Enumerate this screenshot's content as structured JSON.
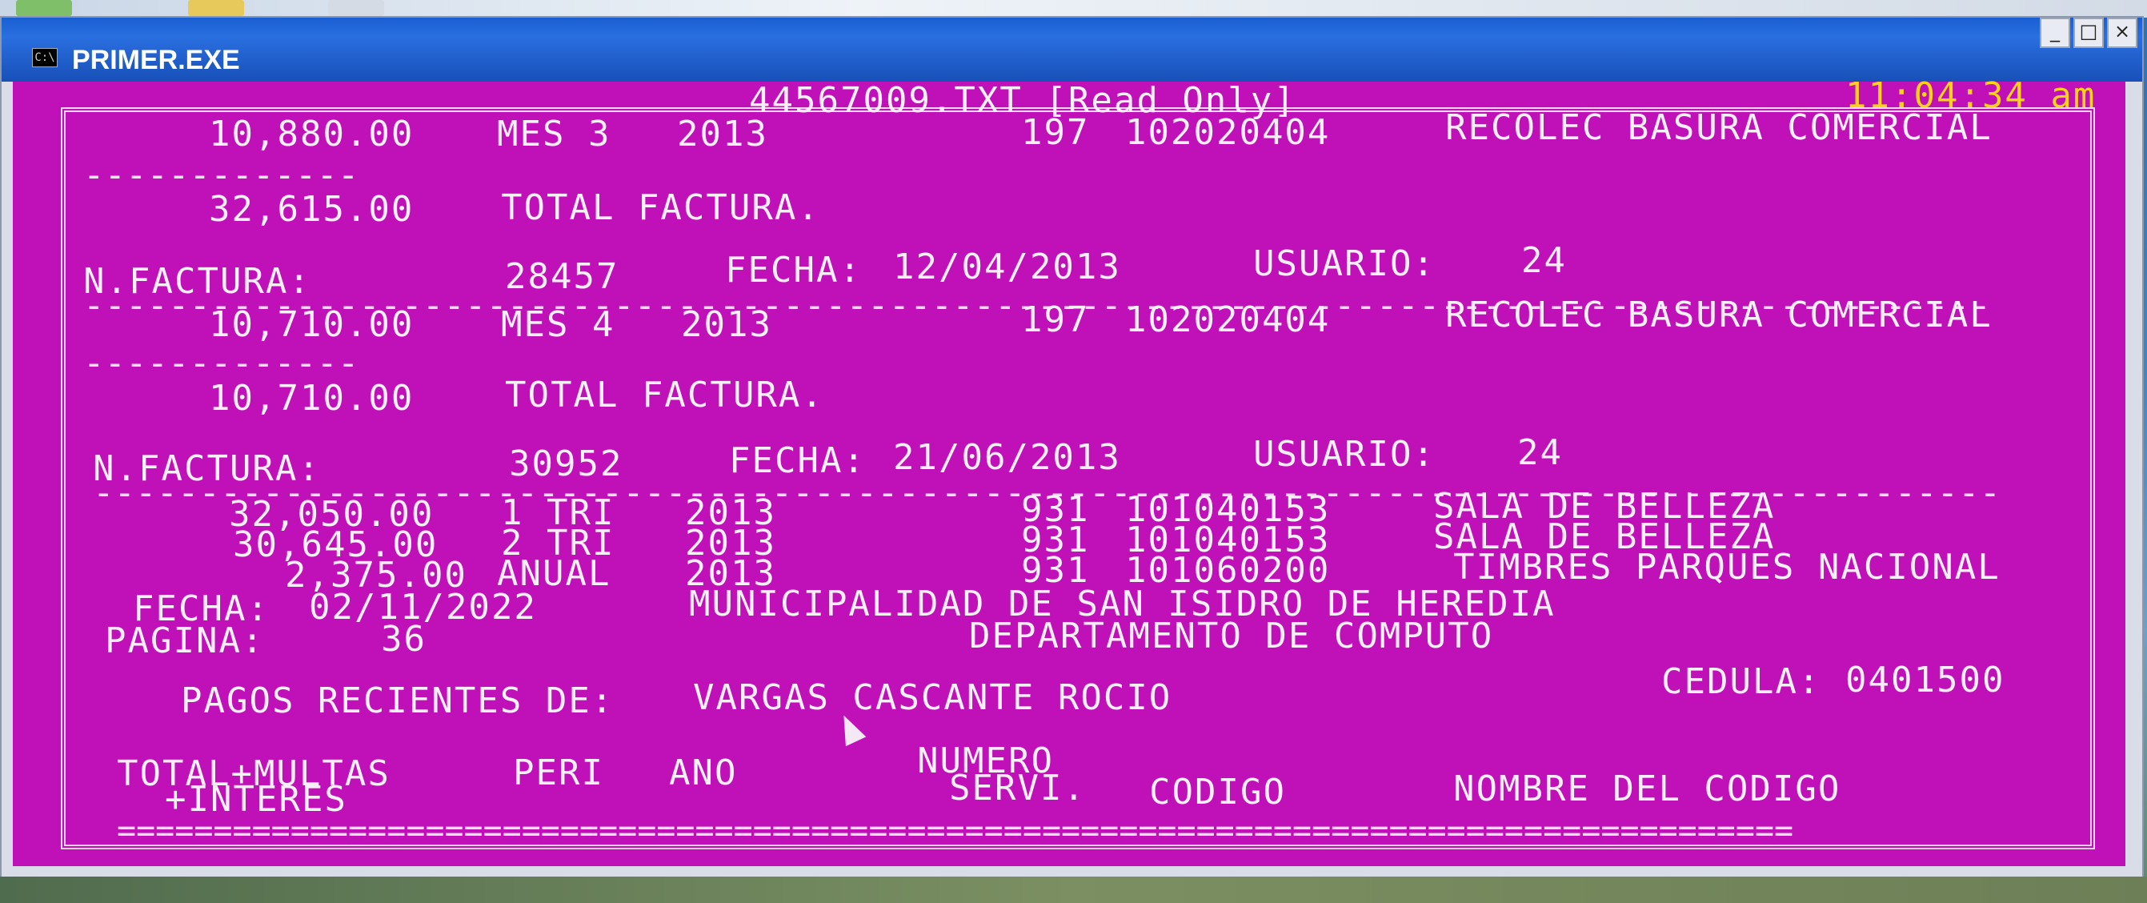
{
  "window": {
    "title": "PRIMER.EXE",
    "icon": "C:\\",
    "controls": [
      "_",
      "□",
      "×"
    ]
  },
  "header": {
    "file_label": "44567009.TXT [Read Only]",
    "clock": "11:04:34 am"
  },
  "lines": {
    "l1_amount": "10,880.00",
    "l1_period": "MES 3",
    "l1_year": "2013",
    "l1_servi": "197",
    "l1_codigo": "102020404",
    "l1_desc": "RECOLEC BASURA COMERCIAL",
    "l2_total": "32,615.00",
    "l2_label": "TOTAL FACTURA.",
    "f2_label": "N.FACTURA:",
    "f2_num": "28457",
    "f2_fecha_label": "FECHA:",
    "f2_fecha": "12/04/2013",
    "f2_usuario_label": "USUARIO:",
    "f2_usuario": "24",
    "l3_amount": "10,710.00",
    "l3_period": "MES 4",
    "l3_year": "2013",
    "l3_servi": "197",
    "l3_codigo": "102020404",
    "l3_desc": "RECOLEC BASURA COMERCIAL",
    "l4_total": "10,710.00",
    "l4_label": "TOTAL FACTURA.",
    "f3_label": "N.FACTURA:",
    "f3_num": "30952",
    "f3_fecha_label": "FECHA:",
    "f3_fecha": "21/06/2013",
    "f3_usuario_label": "USUARIO:",
    "f3_usuario": "24"
  },
  "items": [
    {
      "amount": "32,050.00",
      "period": "1 TRI",
      "year": "2013",
      "servi": "931",
      "codigo": "101040153",
      "desc": "SALA DE BELLEZA"
    },
    {
      "amount": "30,645.00",
      "period": "2 TRI",
      "year": "2013",
      "servi": "931",
      "codigo": "101040153",
      "desc": "SALA DE BELLEZA"
    },
    {
      "amount": "2,375.00",
      "period": "ANUAL",
      "year": "2013",
      "servi": "931",
      "codigo": "101060200",
      "desc": "TIMBRES PARQUES NACIONAL"
    }
  ],
  "report": {
    "fecha_label": "FECHA:",
    "fecha": "02/11/2022",
    "municipality": "MUNICIPALIDAD DE SAN ISIDRO DE HEREDIA",
    "pagina_label": "PAGINA:",
    "pagina": "36",
    "department": "DEPARTAMENTO DE COMPUTO",
    "pagos_label": "PAGOS RECIENTES DE:",
    "pagos_name": "VARGAS CASCANTE ROCIO",
    "cedula_label": "CEDULA:",
    "cedula": "0401500"
  },
  "columns": {
    "total_line1": "TOTAL+MULTAS",
    "total_line2": "+INTERES",
    "peri": "PERI",
    "ano": "ANO",
    "numero_line1": "NUMERO",
    "numero_line2": "SERVI.",
    "codigo": "CODIGO",
    "nombre": "NOMBRE DEL CODIGO"
  },
  "colors": {
    "console_bg": "#c010b8",
    "text": "#f8f0f8",
    "clock": "#ffd21a"
  }
}
